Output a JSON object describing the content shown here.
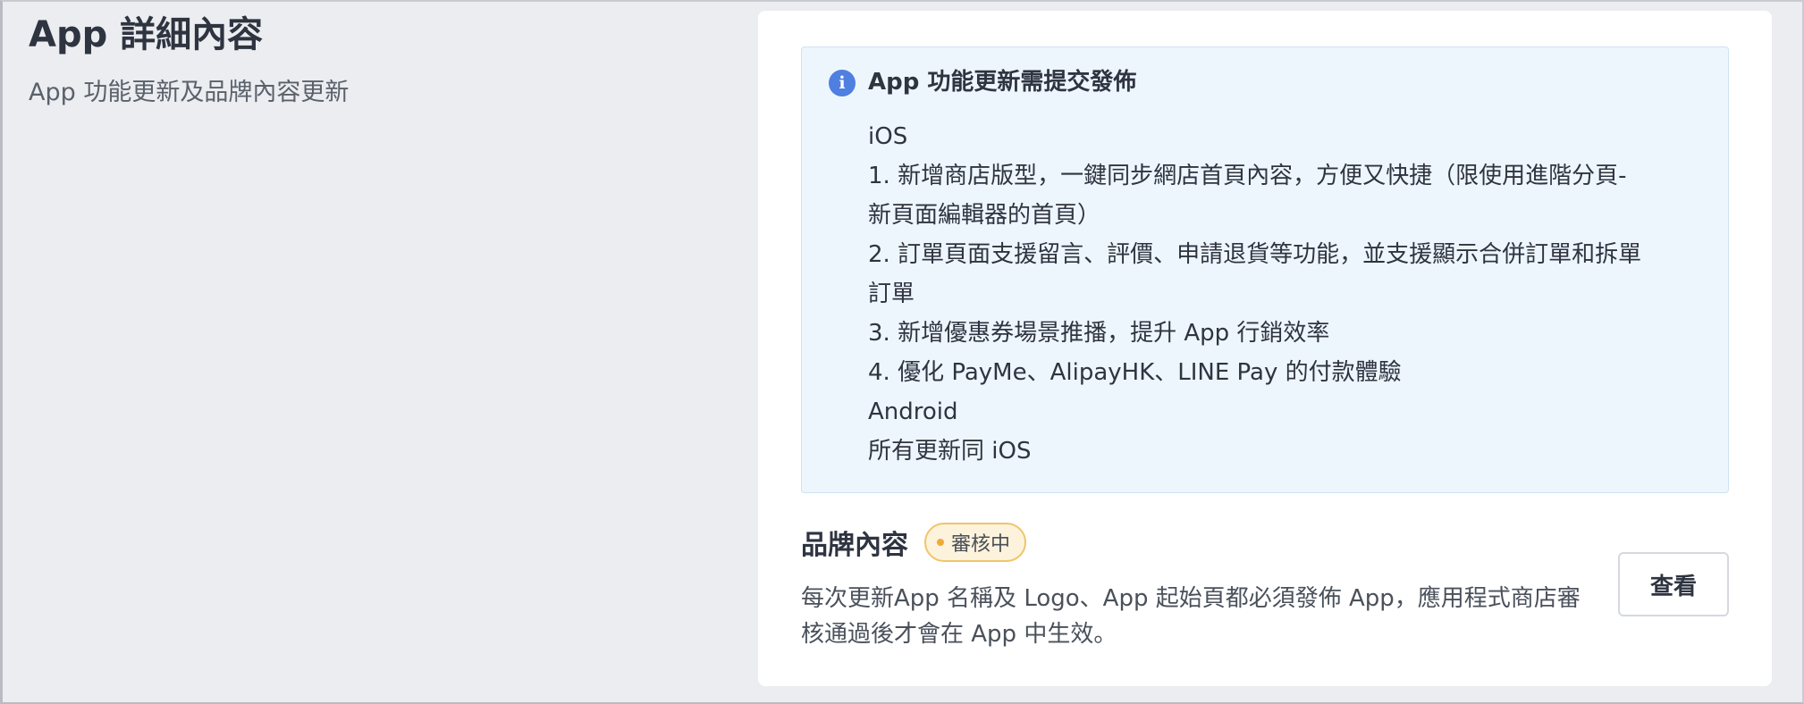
{
  "page": {
    "title": "App 詳細內容",
    "subtitle": "App 功能更新及品牌內容更新"
  },
  "notice": {
    "icon": "info-icon",
    "icon_glyph": "i",
    "title": "App 功能更新需提交發佈",
    "lines": [
      "iOS",
      "1. 新增商店版型，一鍵同步網店首頁內容，方便又快捷（限使用進階分頁-",
      "新頁面編輯器的首頁）",
      "2. 訂單頁面支援留言、評價、申請退貨等功能，並支援顯示合併訂單和拆單",
      "訂單",
      "3. 新增優惠券場景推播，提升 App 行銷效率",
      "4. 優化 PayMe、AlipayHK、LINE Pay 的付款體驗",
      "Android",
      "所有更新同 iOS"
    ]
  },
  "brand": {
    "title": "品牌內容",
    "badge": "審核中",
    "description": "每次更新App 名稱及 Logo、App 起始頁都必須發佈 App，應用程式商店審核通過後才會在 App 中生效。",
    "view_label": "查看"
  },
  "colors": {
    "info_accent": "#4f7fe0",
    "badge_border": "#f0c46a",
    "badge_dot": "#f1a93a",
    "notice_bg": "#eef6fd"
  }
}
